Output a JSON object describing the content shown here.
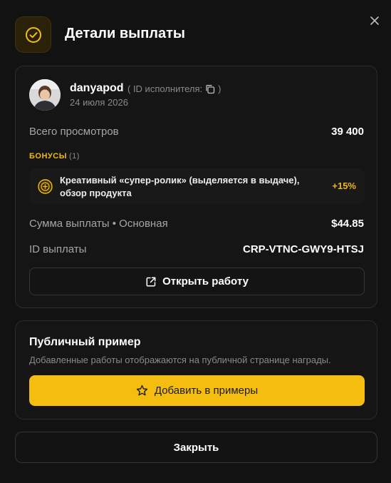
{
  "header": {
    "title": "Детали выплаты",
    "icon": "check-circle-icon",
    "accent": "#f5bd0f"
  },
  "creator": {
    "username": "danyapod",
    "id_label": "( ID исполнителя:",
    "id_close": ")",
    "date": "24 июля 2026"
  },
  "stats": {
    "views_label": "Всего просмотров",
    "views_value": "39 400"
  },
  "bonuses": {
    "heading": "БОНУСЫ",
    "count": "(1)",
    "items": [
      {
        "text": "Креативный «супер-ролик» (выделяется в выдаче), обзор продукта",
        "percent": "+15%"
      }
    ]
  },
  "payout": {
    "amount_label": "Сумма выплаты • Основная",
    "amount_value": "$44.85",
    "id_label": "ID выплаты",
    "id_value": "CRP-VTNC-GWY9-HTSJ",
    "open_button": "Открыть работу"
  },
  "public_example": {
    "title": "Публичный пример",
    "description": "Добавленные работы отображаются на публичной странице награды.",
    "add_button": "Добавить в примеры"
  },
  "footer": {
    "close_button": "Закрыть"
  }
}
